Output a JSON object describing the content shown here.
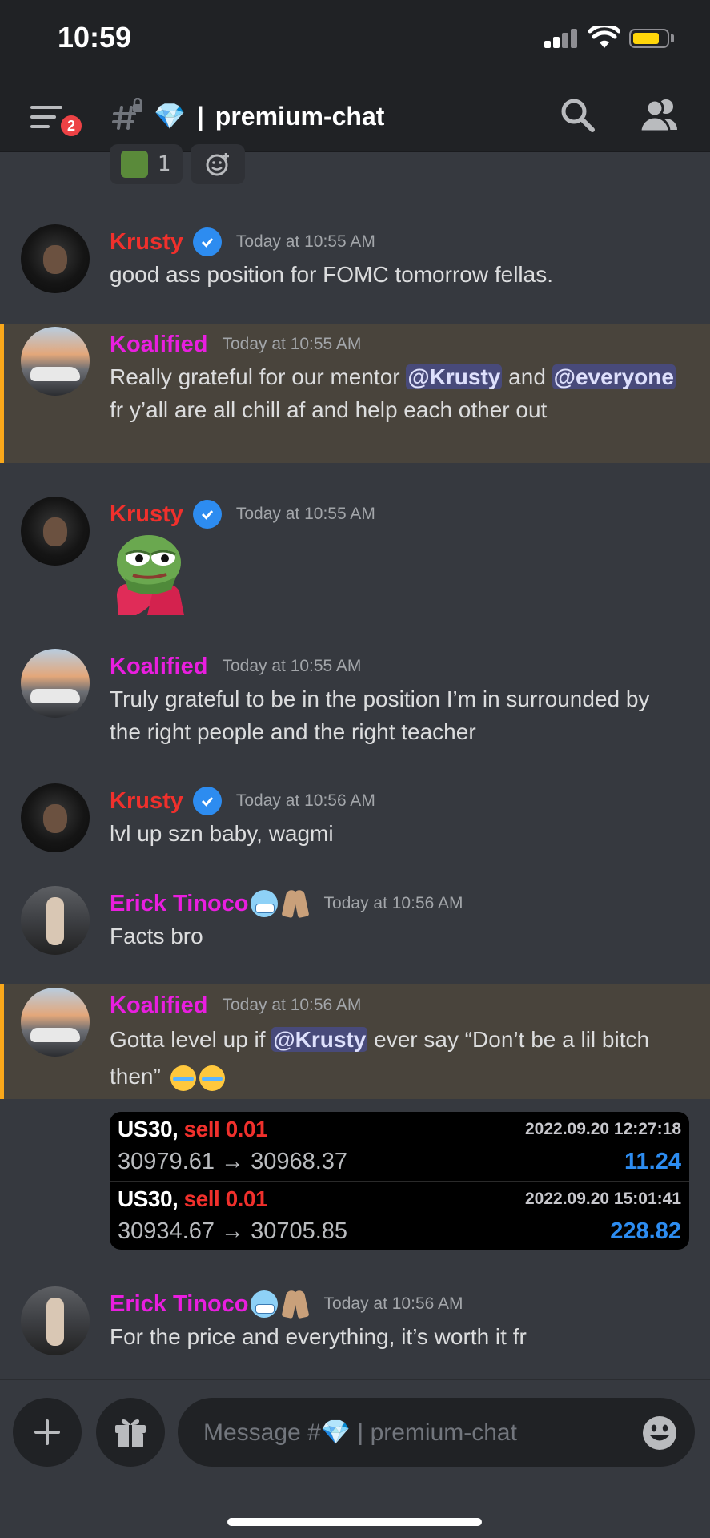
{
  "status_bar": {
    "time": "10:59"
  },
  "header": {
    "notification_count": "2",
    "channel_name": "premium-chat",
    "channel_emoji": "💎",
    "separator": "|"
  },
  "reactions": [
    {
      "count": "1"
    }
  ],
  "messages": [
    {
      "author": "Krusty",
      "verified": true,
      "timestamp": "Today at 10:55 AM",
      "text": "good ass position for FOMC tomorrow fellas."
    },
    {
      "author": "Koalified",
      "timestamp": "Today at 10:55 AM",
      "highlighted": true,
      "parts": [
        "Really grateful for our mentor ",
        "@Krusty",
        " and ",
        "@everyone",
        " fr y’all are all chill af and help each other out"
      ]
    },
    {
      "author": "Krusty",
      "verified": true,
      "timestamp": "Today at 10:55 AM",
      "sticker": "pepe-heart"
    },
    {
      "author": "Koalified",
      "timestamp": "Today at 10:55 AM",
      "text": "Truly grateful to be in the position I’m in surrounded by the right people and the right teacher"
    },
    {
      "author": "Krusty",
      "verified": true,
      "timestamp": "Today at 10:56 AM",
      "text": "lvl up szn baby,  wagmi"
    },
    {
      "author": "Erick Tinoco",
      "timestamp": "Today at 10:56 AM",
      "text": "Facts bro"
    },
    {
      "author": "Koalified",
      "timestamp": "Today at 10:56 AM",
      "highlighted": true,
      "parts": [
        "Gotta level up if ",
        "@Krusty",
        " ever say “Don’t be a lil bitch then”"
      ]
    },
    {
      "author": "Erick Tinoco",
      "timestamp": "Today at 10:56 AM",
      "text": "For the price and everything, it’s worth it fr"
    }
  ],
  "trades": [
    {
      "symbol": "US30,",
      "side": "sell 0.01",
      "datetime": "2022.09.20 12:27:18",
      "prices": "30979.61 → 30968.37",
      "profit": "11.24"
    },
    {
      "symbol": "US30,",
      "side": "sell 0.01",
      "datetime": "2022.09.20 15:01:41",
      "prices": "30934.67 → 30705.85",
      "profit": "228.82"
    }
  ],
  "composer": {
    "placeholder": "Message #💎 | premium-chat"
  },
  "colors": {
    "accent_red": "#f0302c",
    "accent_pink": "#e91edf",
    "highlight_bar": "#faa81a",
    "profit_blue": "#2d8cf0"
  }
}
